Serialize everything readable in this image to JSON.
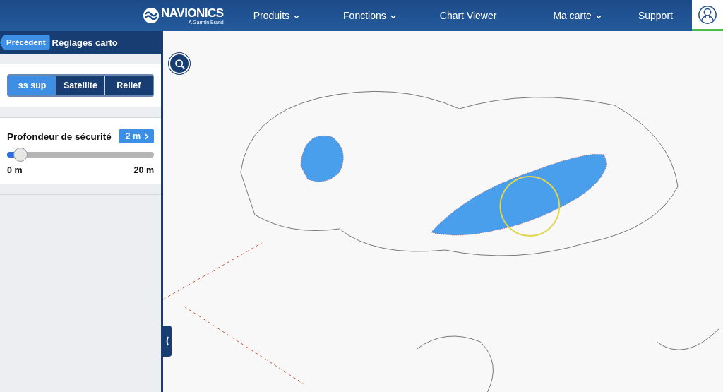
{
  "header": {
    "logo": {
      "name": "NAVIONICS",
      "tagline": "A Garmin Brand"
    },
    "nav": [
      {
        "label": "Produits",
        "dropdown": true
      },
      {
        "label": "Fonctions",
        "dropdown": true
      },
      {
        "label": "Chart Viewer",
        "dropdown": false
      },
      {
        "label": "Ma carte",
        "dropdown": true
      },
      {
        "label": "Support",
        "dropdown": false
      }
    ],
    "account": {
      "selected": true
    }
  },
  "sidebar": {
    "back_button": "Précédent",
    "title": "Réglages carto",
    "map_types": [
      {
        "label": "ss sup",
        "selected": true
      },
      {
        "label": "Satellite",
        "selected": false
      },
      {
        "label": "Relief",
        "selected": false
      }
    ],
    "safety_depth": {
      "label": "Profondeur de sécurité",
      "value": "2 m",
      "level": 0.09,
      "min": "0 m",
      "max": "20 m"
    }
  }
}
